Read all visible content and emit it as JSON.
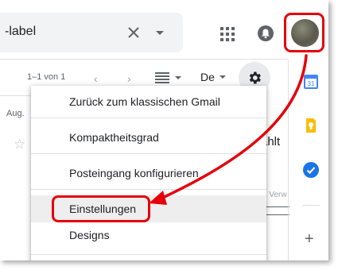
{
  "header": {
    "search_text": "-label",
    "icons": [
      "clear-icon",
      "dropdown-icon",
      "apps-icon",
      "notifications-icon",
      "avatar"
    ]
  },
  "toolbar": {
    "pager_text": "1–1 von 1",
    "language_label": "De",
    "icons": [
      "chevron-left-icon",
      "chevron-right-icon",
      "list-density-icon",
      "gear-icon"
    ]
  },
  "list": {
    "date_label": "Aug.",
    "partial_text_1": "ählt",
    "partial_text_2": "– Verw"
  },
  "menu": {
    "items": [
      {
        "label": "Zurück zum klassischen Gmail"
      },
      {
        "label": "Kompaktheitsgrad"
      },
      {
        "label": "Posteingang konfigurieren"
      },
      {
        "label": "Einstellungen",
        "highlighted": true
      },
      {
        "label": "Designs"
      }
    ]
  },
  "sidebar": {
    "icons": [
      "calendar-icon",
      "keep-icon",
      "tasks-icon",
      "add-icon"
    ],
    "calendar_badge": "31",
    "add_label": "+"
  },
  "annotation_color": "#e5000a"
}
